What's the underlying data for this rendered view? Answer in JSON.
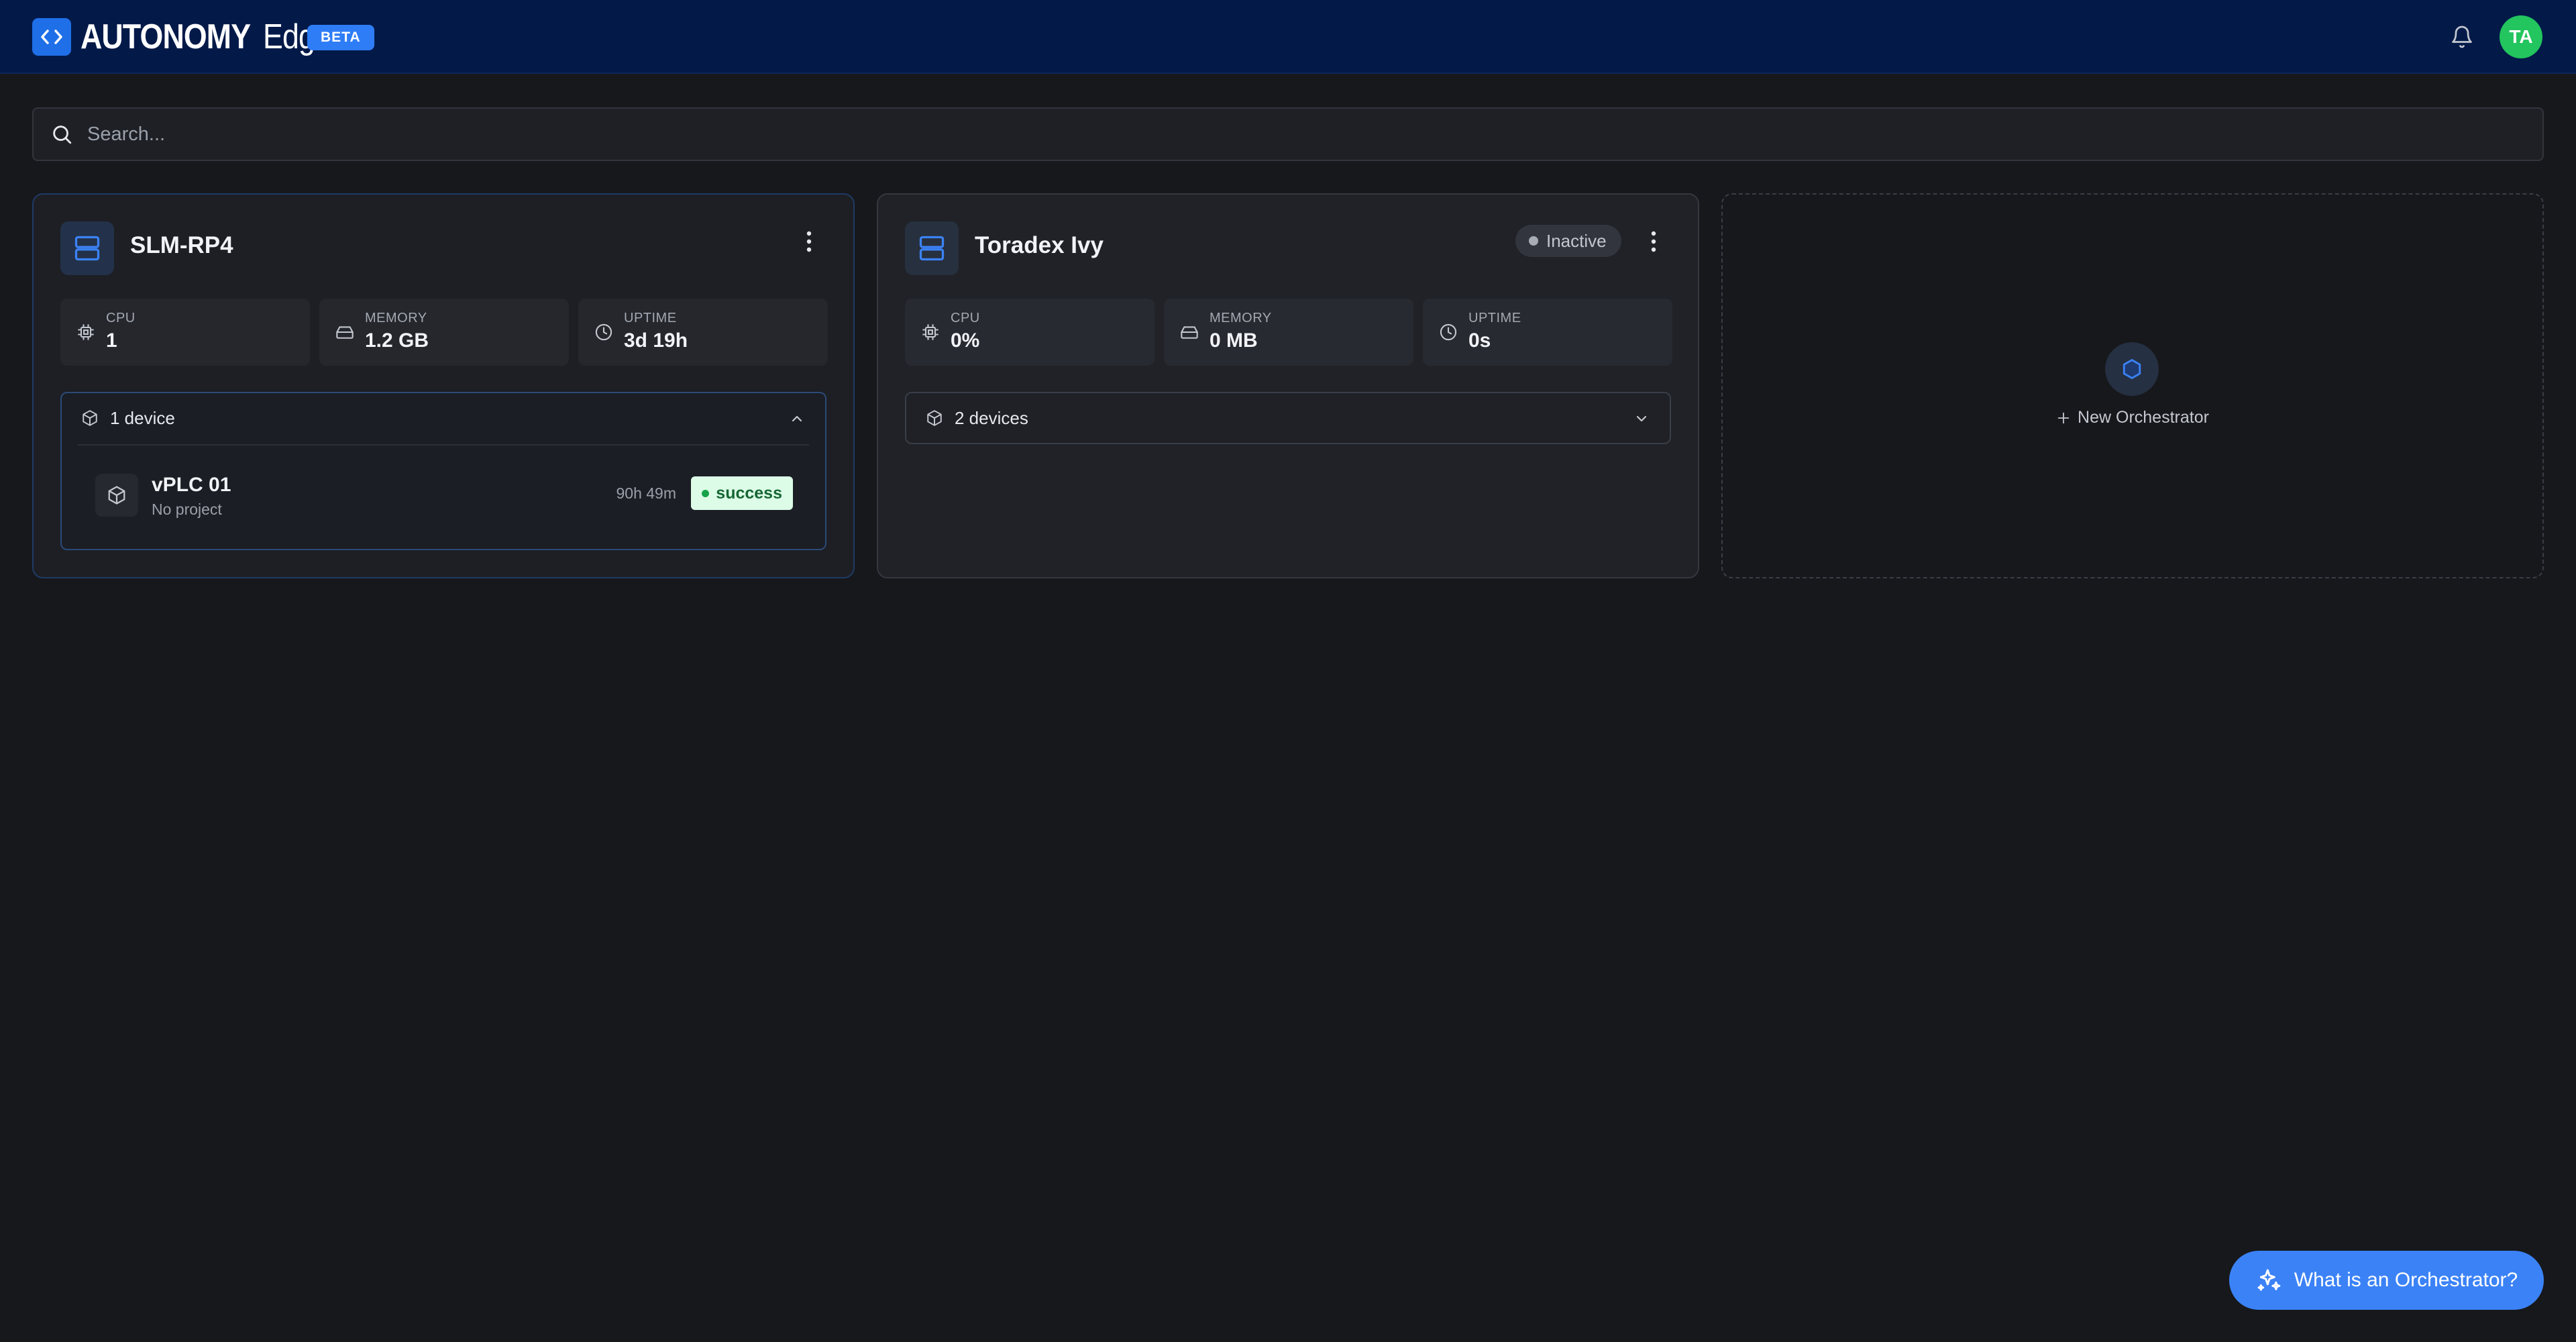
{
  "header": {
    "brand_strong": "AUTONOMY",
    "brand_light": "Edge",
    "beta_label": "BETA",
    "avatar_initials": "TA",
    "icons": [
      "logo-code-icon",
      "bell-icon"
    ]
  },
  "search": {
    "placeholder": "Search...",
    "value": ""
  },
  "orchestrators": [
    {
      "name": "SLM-RP4",
      "status": null,
      "metrics": {
        "cpu_label": "CPU",
        "cpu_value": "1",
        "memory_label": "MEMORY",
        "memory_value": "1.2 GB",
        "uptime_label": "UPTIME",
        "uptime_value": "3d 19h"
      },
      "devices_summary": "1 device",
      "expanded": true,
      "devices": [
        {
          "name": "vPLC 01",
          "project": "No project",
          "uptime": "90h 49m",
          "status": "success"
        }
      ]
    },
    {
      "name": "Toradex Ivy",
      "status": "Inactive",
      "metrics": {
        "cpu_label": "CPU",
        "cpu_value": "0%",
        "memory_label": "MEMORY",
        "memory_value": "0 MB",
        "uptime_label": "UPTIME",
        "uptime_value": "0s"
      },
      "devices_summary": "2 devices",
      "expanded": false,
      "devices": []
    }
  ],
  "new_orchestrator": {
    "label": "New Orchestrator"
  },
  "help": {
    "label": "What is an Orchestrator?"
  },
  "colors": {
    "header_bg": "#031a49",
    "accent": "#3b82f6",
    "avatar": "#22c55e",
    "success_bg": "#dcfce7",
    "success_text": "#166534",
    "page_bg": "#17181c"
  }
}
